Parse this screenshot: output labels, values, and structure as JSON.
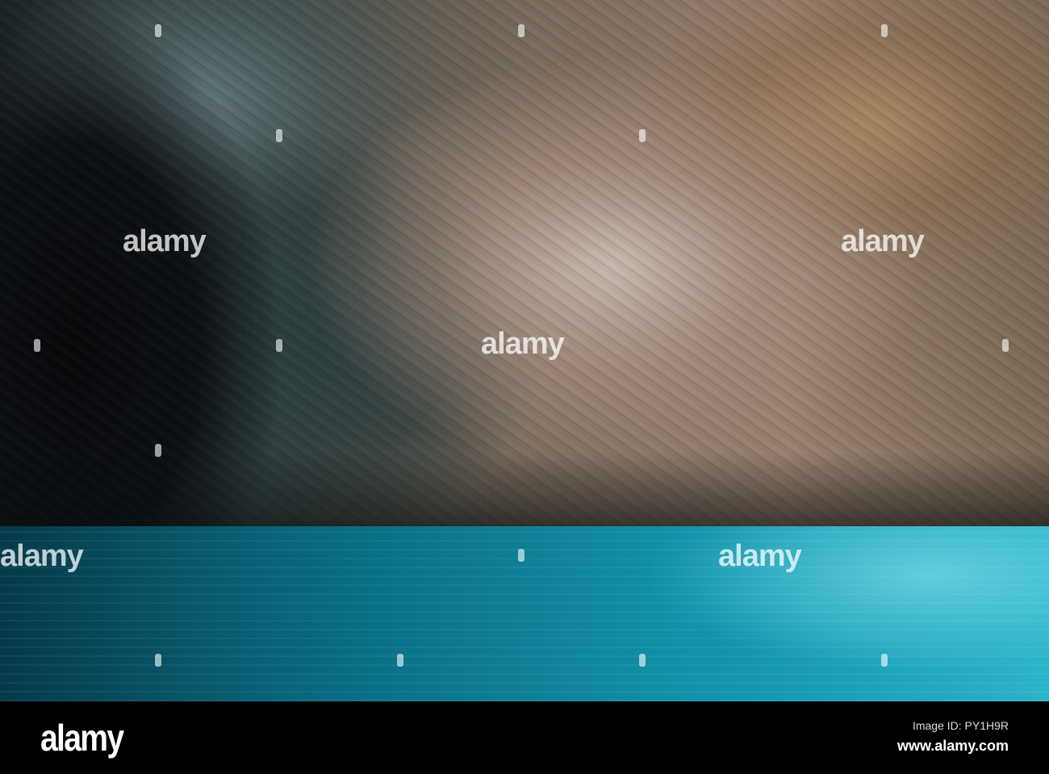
{
  "photo": {
    "watermark_text": "alamy"
  },
  "footer": {
    "logo": "alamy",
    "image_id": "Image ID: PY1H9R",
    "url": "www.alamy.com"
  }
}
